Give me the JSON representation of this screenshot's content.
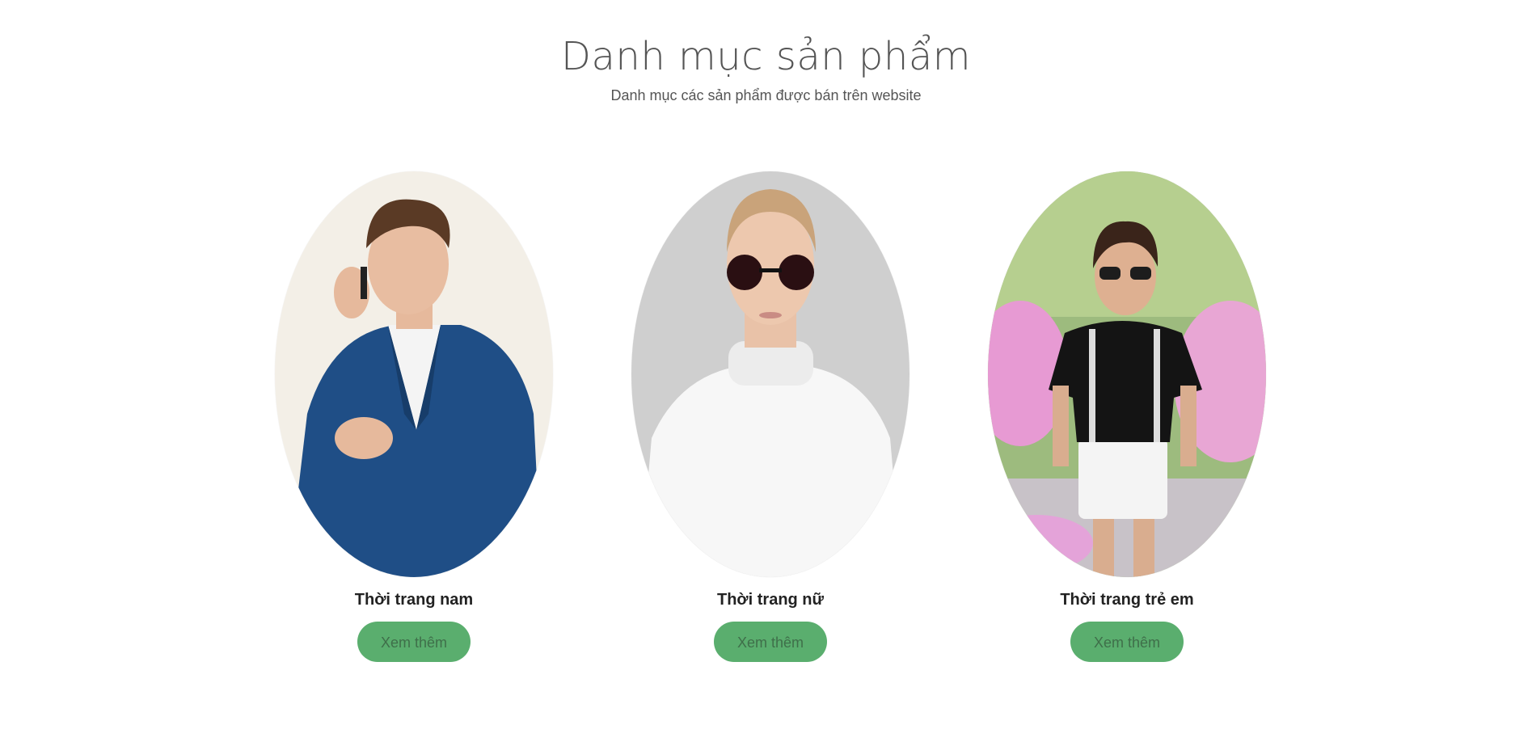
{
  "section": {
    "title": "Danh mục sản phẩm",
    "subtitle": "Danh mục các sản phẩm được bán trên website"
  },
  "categories": [
    {
      "name": "Thời trang nam",
      "button_label": "Xem thêm",
      "image": "man-in-blue-suit-on-phone"
    },
    {
      "name": "Thời trang nữ",
      "button_label": "Xem thêm",
      "image": "woman-with-sunglasses-white-turtleneck"
    },
    {
      "name": "Thời trang trẻ em",
      "button_label": "Xem thêm",
      "image": "boy-with-sunglasses-black-tshirt"
    }
  ],
  "colors": {
    "button_bg": "#5aae6e",
    "button_text": "#3f6f4a"
  }
}
